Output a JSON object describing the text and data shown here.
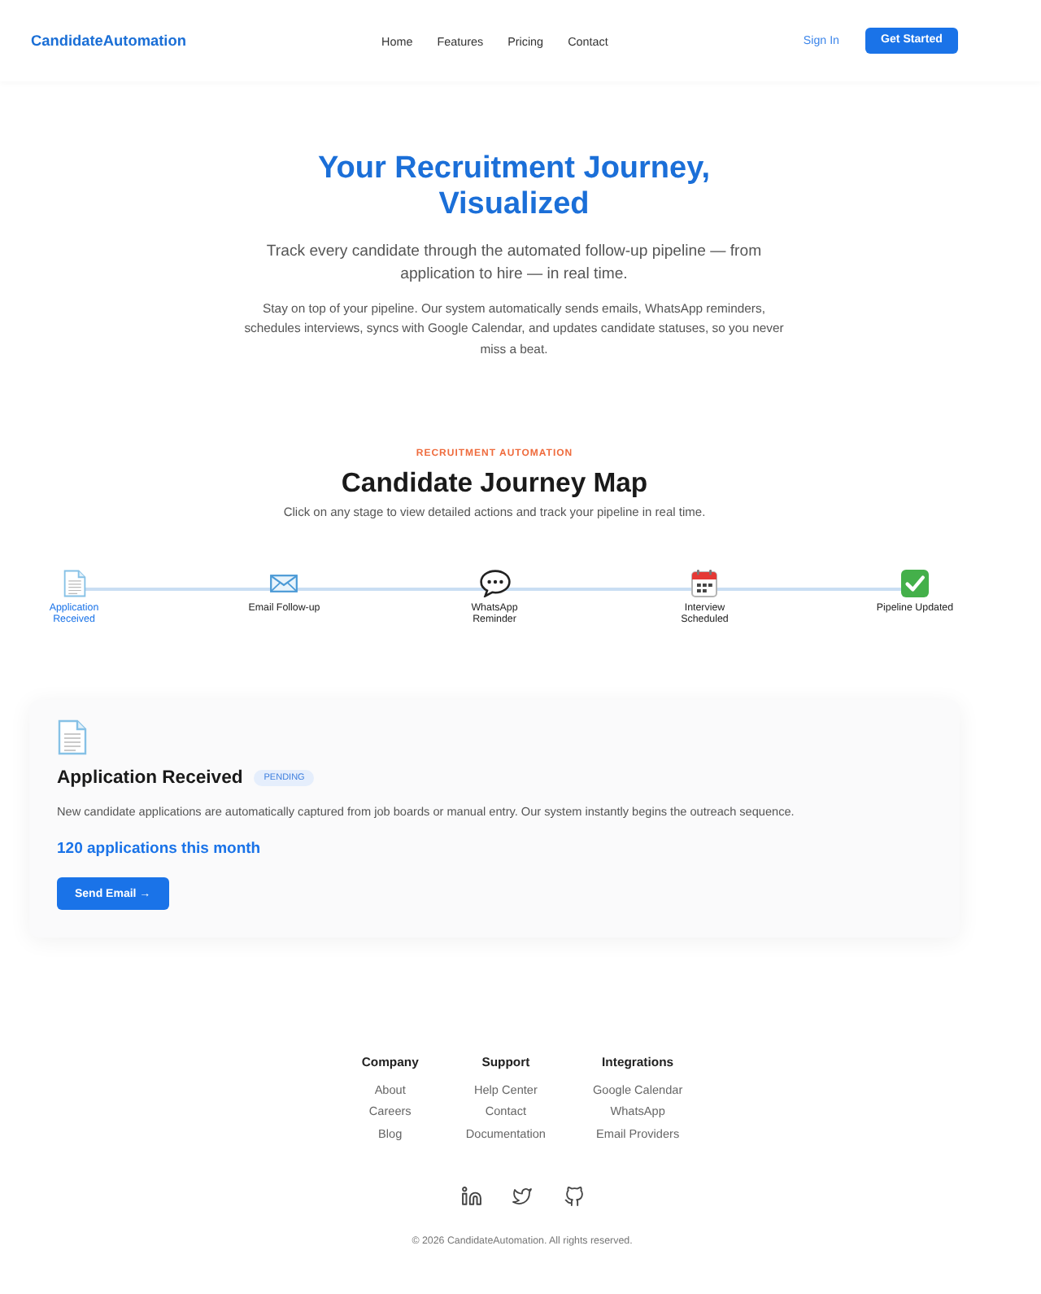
{
  "header": {
    "logo": "CandidateAutomation",
    "nav": [
      "Home",
      "Features",
      "Pricing",
      "Contact"
    ],
    "sign_in": "Sign In",
    "cta": "Get Started"
  },
  "hero": {
    "title": "Your Recruitment Journey, Visualized",
    "subtitle": "Track every candidate through the automated follow-up pipeline — from application to hire — in real time.",
    "description": "Stay on top of your pipeline. Our system automatically sends emails, WhatsApp reminders, schedules interviews, syncs with Google Calendar, and updates candidate statuses, so you never miss a beat."
  },
  "journey": {
    "eyebrow": "RECRUITMENT AUTOMATION",
    "title": "Candidate Journey Map",
    "subtitle": "Click on any stage to view detailed actions and track your pipeline in real time.",
    "stages": [
      {
        "kind": "document",
        "label": "Application Received",
        "selected": true
      },
      {
        "kind": "email",
        "label": "Email Follow-up",
        "selected": false
      },
      {
        "kind": "chat",
        "label": "WhatsApp Reminder",
        "selected": false
      },
      {
        "kind": "calendar",
        "label": "Interview Scheduled",
        "selected": false
      },
      {
        "kind": "check",
        "label": "Pipeline Updated",
        "selected": false
      }
    ],
    "detail": {
      "kind": "document",
      "title": "Application Received",
      "badge": "PENDING",
      "description": "New candidate applications are automatically captured from job boards or manual entry. Our system instantly begins the outreach sequence.",
      "stat": "120 applications this month",
      "action": "Send Email →"
    }
  },
  "footer": {
    "columns": [
      {
        "heading": "Company",
        "links": [
          "About",
          "Careers",
          "Blog"
        ]
      },
      {
        "heading": "Support",
        "links": [
          "Help Center",
          "Contact",
          "Documentation"
        ]
      },
      {
        "heading": "Integrations",
        "links": [
          "Google Calendar",
          "WhatsApp",
          "Email Providers"
        ]
      }
    ],
    "social": [
      {
        "kind": "linkedin"
      },
      {
        "kind": "twitter"
      },
      {
        "kind": "github"
      }
    ],
    "copyright": "© 2026 CandidateAutomation. All rights reserved."
  }
}
